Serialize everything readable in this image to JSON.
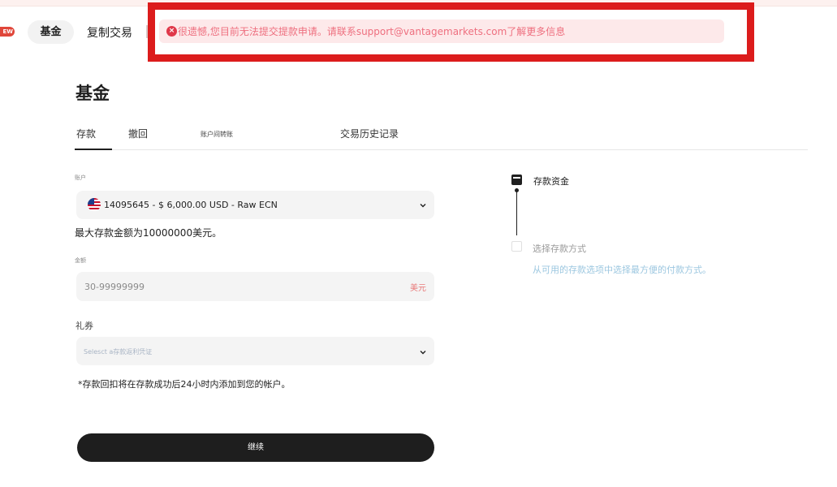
{
  "nav": {
    "new_badge": "EW",
    "funds": "基金",
    "copy_trading": "复制交易"
  },
  "alert": {
    "message": "很遗憾,您目前无法提交提款申请。请联系support@vantagemarkets.com了解更多信息",
    "icon": "error-x-icon",
    "frame_color": "#dc1c1c"
  },
  "page": {
    "title": "基金"
  },
  "tabs": [
    {
      "label": "存款",
      "active": true
    },
    {
      "label": "撤回"
    },
    {
      "label": "账户间转账"
    },
    {
      "label": "交易历史记录"
    }
  ],
  "form": {
    "account_label": "账户",
    "account_value": "14095645 - $ 6,000.00 USD - Raw ECN",
    "max_note": "最大存款金额为10000000美元。",
    "amount_label": "金额",
    "amount_placeholder": "30-99999999",
    "amount_currency": "美元",
    "voucher_label": "礼券",
    "voucher_placeholder": "Selesct a存款返利凭证",
    "footnote": "*存款回扣将在存款成功后24小时内添加到您的帐户。",
    "continue_label": "继续"
  },
  "steps": [
    {
      "title": "存款资金",
      "active": true
    },
    {
      "title": "选择存款方式",
      "description": "从可用的存款选项中选择最方便的付款方式。"
    }
  ],
  "colors": {
    "accent_dark": "#1e1e1e",
    "alert_text": "#ee6f7f",
    "alert_bg": "#fde9ea",
    "currency": "#e87878",
    "step_desc": "#9cc7e0"
  }
}
